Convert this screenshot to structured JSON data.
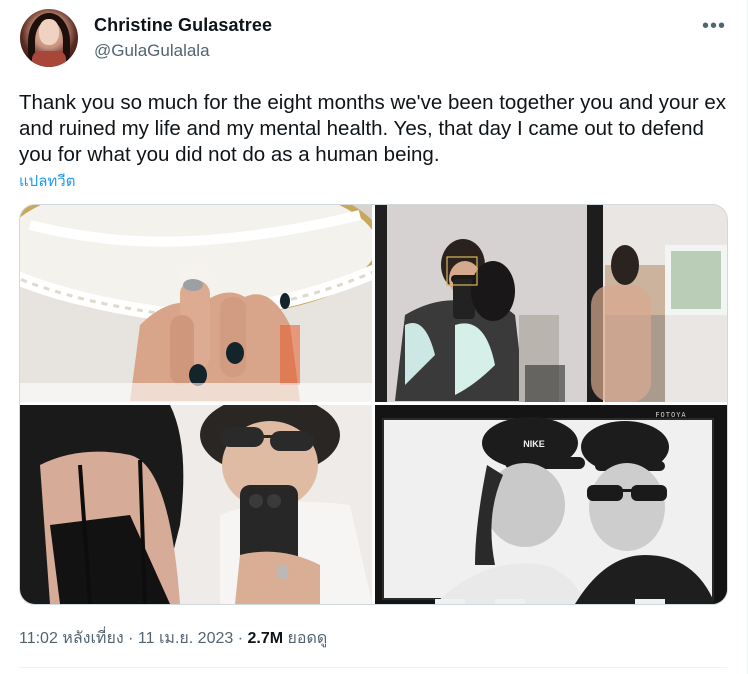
{
  "author": {
    "name": "Christine Gulasatree",
    "handle": "@GulaGulalala"
  },
  "tweet": {
    "text": "Thank you so much for the eight months we've been together you and your ex and ruined my life and my mental health. Yes, that day I came out to defend you for what you did not do as a human being.",
    "translate_label": "แปลทวีต",
    "more_icon": "•••"
  },
  "media": {
    "photos": [
      "photo-1",
      "photo-2",
      "photo-3",
      "photo-4"
    ],
    "cap_brand": "NIKE",
    "frame_text": "FOTOYA"
  },
  "footer": {
    "time": "11:02 หลังเที่ยง",
    "sep1": " · ",
    "date": "11 เม.ย. 2023",
    "sep2": " · ",
    "views_count": "2.7M",
    "views_label": " ยอดดู"
  }
}
